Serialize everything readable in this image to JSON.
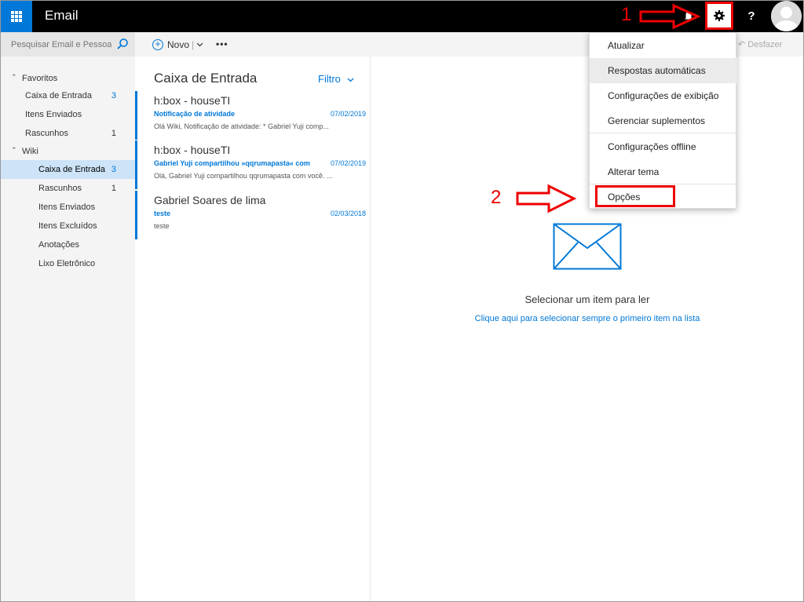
{
  "app": {
    "title": "Email"
  },
  "search": {
    "placeholder": "Pesquisar Email e Pessoas"
  },
  "commands": {
    "new_label": "Novo",
    "undo_label": "Desfazer"
  },
  "nav": {
    "favorites_label": "Favoritos",
    "favorites": [
      {
        "label": "Caixa de Entrada",
        "count": "3"
      },
      {
        "label": "Itens Enviados",
        "count": ""
      },
      {
        "label": "Rascunhos",
        "count": "1"
      }
    ],
    "account_label": "Wiki",
    "folders": [
      {
        "label": "Caixa de Entrada",
        "count": "3"
      },
      {
        "label": "Rascunhos",
        "count": "1"
      },
      {
        "label": "Itens Enviados",
        "count": ""
      },
      {
        "label": "Itens Excluídos",
        "count": ""
      },
      {
        "label": "Anotações",
        "count": ""
      },
      {
        "label": "Lixo Eletrônico",
        "count": ""
      }
    ]
  },
  "list": {
    "title": "Caixa de Entrada",
    "filter_label": "Filtro",
    "messages": [
      {
        "from": "h:box - houseTI",
        "subject": "Notificação de atividade",
        "date": "07/02/2019",
        "preview": "Olá Wiki, Notificação de atividade: * Gabriel Yuji comp..."
      },
      {
        "from": "h:box - houseTI",
        "subject": "Gabriel Yuji compartilhou »qqrumapasta« com",
        "date": "07/02/2019",
        "preview": "Olá, Gabriel Yuji compartilhou qqrumapasta com você. ..."
      },
      {
        "from": "Gabriel Soares de lima",
        "subject": "teste",
        "date": "02/03/2018",
        "preview": "teste"
      }
    ]
  },
  "reading": {
    "prompt": "Selecionar um item para ler",
    "link": "Clique aqui para selecionar sempre o primeiro item na lista"
  },
  "settings_menu": {
    "items": [
      "Atualizar",
      "Respostas automáticas",
      "Configurações de exibição",
      "Gerenciar suplementos",
      "Configurações offline",
      "Alterar tema",
      "Opções"
    ]
  },
  "annotations": {
    "step1": "1",
    "step2": "2"
  },
  "colors": {
    "accent": "#0078d7",
    "annotation": "#ee0000",
    "topbar": "#000000"
  },
  "icons": [
    "app-launcher-icon",
    "bell-icon",
    "gear-icon",
    "help-icon",
    "avatar-icon",
    "search-icon",
    "plus-circle-icon",
    "more-icon",
    "undo-icon",
    "envelope-icon"
  ]
}
